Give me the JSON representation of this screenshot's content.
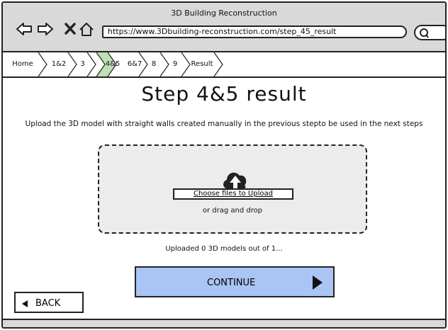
{
  "window": {
    "title": "3D Building Reconstruction",
    "url": "https://www.3Dbuilding-reconstruction.com/step_45_result"
  },
  "nav_icons": [
    "back-arrow-icon",
    "forward-arrow-icon",
    "close-icon",
    "home-icon"
  ],
  "breadcrumb": {
    "items": [
      {
        "label": "Home",
        "active": false
      },
      {
        "label": "1&2",
        "active": false
      },
      {
        "label": "3",
        "active": false
      },
      {
        "label": "4&5",
        "active": true
      },
      {
        "label": "6&7",
        "active": false
      },
      {
        "label": "8",
        "active": false
      },
      {
        "label": "9",
        "active": false
      },
      {
        "label": "Result",
        "active": false
      }
    ],
    "active_color": "#bfe0b0"
  },
  "main": {
    "title": "Step 4&5 result",
    "instructions": "Upload the 3D model with straight walls created manually in the previous stepto be used in the next steps",
    "dropzone": {
      "choose_label": "Choose files to Upload",
      "drag_label": "or drag and drop"
    },
    "status": "Uploaded 0 3D models out of 1..."
  },
  "actions": {
    "continue_label": "CONTINUE",
    "back_label": "BACK",
    "continue_color": "#a9c4f5"
  }
}
